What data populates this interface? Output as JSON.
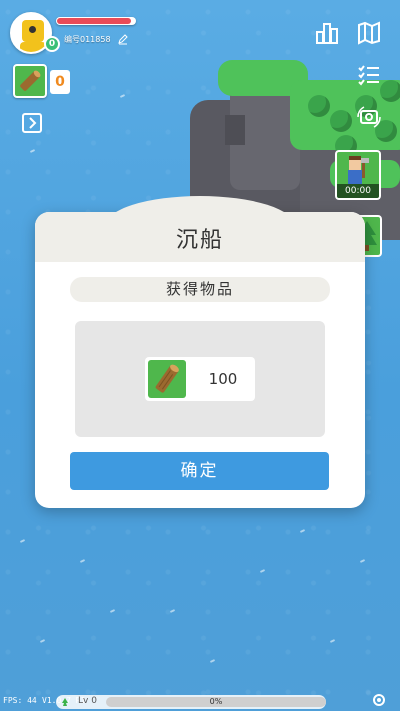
{
  "hud": {
    "player_id": "编号011858",
    "player_level": "0",
    "hp_percent": 95,
    "wood_count": "0"
  },
  "camera": {
    "timer": "00:00"
  },
  "dialog": {
    "title": "沉船",
    "subtitle": "获得物品",
    "item": {
      "icon": "wood-log-icon",
      "quantity": "100"
    },
    "confirm_label": "确定"
  },
  "bottom": {
    "fps": "FPS: 44",
    "version": "V1.0.7  R1",
    "level_label": "Lv 0",
    "xp_percent_text": "0%",
    "xp_percent": 0
  },
  "colors": {
    "ocean": "#4fa3df",
    "grass": "#4fb74c",
    "confirm": "#3e9ae0",
    "hp": "#e94b58",
    "wood_count": "#f08a1f"
  }
}
